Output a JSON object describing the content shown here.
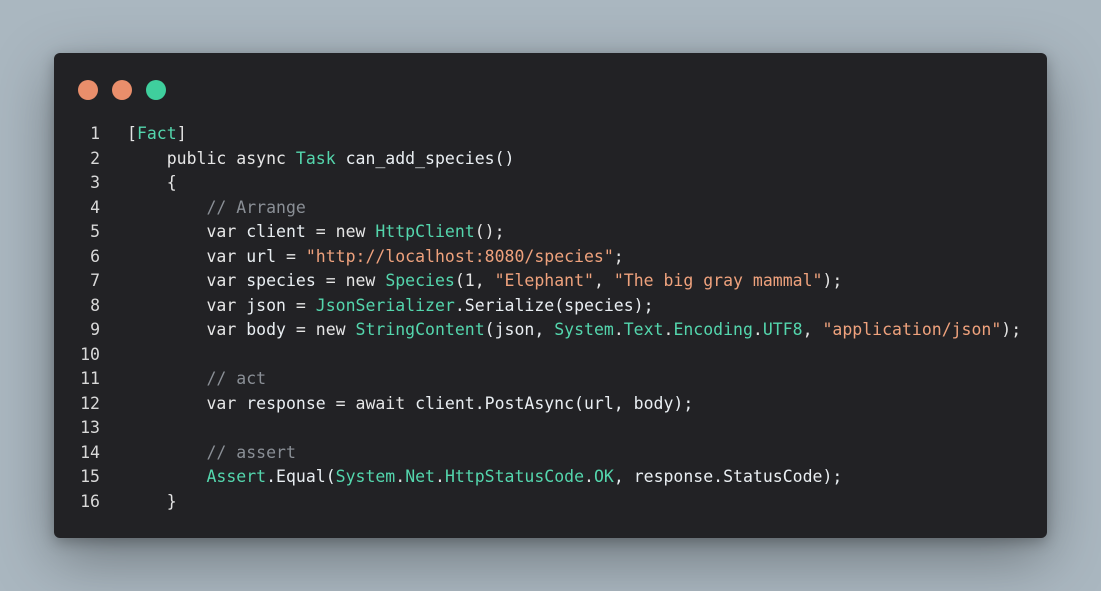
{
  "colors": {
    "background": "#aab7c0",
    "window": "#222225",
    "dot_close": "#e98e6b",
    "dot_minimize": "#e98e6b",
    "dot_maximize": "#3fcf9d"
  },
  "lines": [
    {
      "n": "1",
      "tokens": [
        {
          "t": "[",
          "c": "pun"
        },
        {
          "t": "Fact",
          "c": "cls"
        },
        {
          "t": "]",
          "c": "pun"
        }
      ]
    },
    {
      "n": "2",
      "tokens": [
        {
          "t": "    public async ",
          "c": "kw"
        },
        {
          "t": "Task",
          "c": "cls"
        },
        {
          "t": " can_add_species()",
          "c": "id"
        }
      ]
    },
    {
      "n": "3",
      "tokens": [
        {
          "t": "    {",
          "c": "pun"
        }
      ]
    },
    {
      "n": "4",
      "tokens": [
        {
          "t": "        // Arrange",
          "c": "cmt"
        }
      ]
    },
    {
      "n": "5",
      "tokens": [
        {
          "t": "        var ",
          "c": "kw"
        },
        {
          "t": "client",
          "c": "id"
        },
        {
          "t": " = new ",
          "c": "kw"
        },
        {
          "t": "HttpClient",
          "c": "cls"
        },
        {
          "t": "();",
          "c": "pun"
        }
      ]
    },
    {
      "n": "6",
      "tokens": [
        {
          "t": "        var ",
          "c": "kw"
        },
        {
          "t": "url",
          "c": "id"
        },
        {
          "t": " = ",
          "c": "kw"
        },
        {
          "t": "\"http://localhost:8080/species\"",
          "c": "str"
        },
        {
          "t": ";",
          "c": "pun"
        }
      ]
    },
    {
      "n": "7",
      "tokens": [
        {
          "t": "        var ",
          "c": "kw"
        },
        {
          "t": "species",
          "c": "id"
        },
        {
          "t": " = new ",
          "c": "kw"
        },
        {
          "t": "Species",
          "c": "cls"
        },
        {
          "t": "(1, ",
          "c": "pun"
        },
        {
          "t": "\"Elephant\"",
          "c": "str"
        },
        {
          "t": ", ",
          "c": "pun"
        },
        {
          "t": "\"The big gray mammal\"",
          "c": "str"
        },
        {
          "t": ");",
          "c": "pun"
        }
      ]
    },
    {
      "n": "8",
      "tokens": [
        {
          "t": "        var ",
          "c": "kw"
        },
        {
          "t": "json",
          "c": "id"
        },
        {
          "t": " = ",
          "c": "kw"
        },
        {
          "t": "JsonSerializer",
          "c": "cls"
        },
        {
          "t": ".Serialize(species);",
          "c": "id"
        }
      ]
    },
    {
      "n": "9",
      "tokens": [
        {
          "t": "        var ",
          "c": "kw"
        },
        {
          "t": "body",
          "c": "id"
        },
        {
          "t": " = new ",
          "c": "kw"
        },
        {
          "t": "StringContent",
          "c": "cls"
        },
        {
          "t": "(json, ",
          "c": "id"
        },
        {
          "t": "System",
          "c": "cls"
        },
        {
          "t": ".",
          "c": "pun"
        },
        {
          "t": "Text",
          "c": "cls"
        },
        {
          "t": ".",
          "c": "pun"
        },
        {
          "t": "Encoding",
          "c": "cls"
        },
        {
          "t": ".",
          "c": "pun"
        },
        {
          "t": "UTF8",
          "c": "cls"
        },
        {
          "t": ", ",
          "c": "pun"
        },
        {
          "t": "\"application/json\"",
          "c": "str"
        },
        {
          "t": ");",
          "c": "pun"
        }
      ]
    },
    {
      "n": "10",
      "tokens": []
    },
    {
      "n": "11",
      "tokens": [
        {
          "t": "        // act",
          "c": "cmt"
        }
      ]
    },
    {
      "n": "12",
      "tokens": [
        {
          "t": "        var ",
          "c": "kw"
        },
        {
          "t": "response",
          "c": "id"
        },
        {
          "t": " = await ",
          "c": "kw"
        },
        {
          "t": "client.PostAsync(url, body);",
          "c": "id"
        }
      ]
    },
    {
      "n": "13",
      "tokens": []
    },
    {
      "n": "14",
      "tokens": [
        {
          "t": "        // assert",
          "c": "cmt"
        }
      ]
    },
    {
      "n": "15",
      "tokens": [
        {
          "t": "        ",
          "c": "kw"
        },
        {
          "t": "Assert",
          "c": "cls"
        },
        {
          "t": ".Equal(",
          "c": "id"
        },
        {
          "t": "System",
          "c": "cls"
        },
        {
          "t": ".",
          "c": "pun"
        },
        {
          "t": "Net",
          "c": "cls"
        },
        {
          "t": ".",
          "c": "pun"
        },
        {
          "t": "HttpStatusCode",
          "c": "cls"
        },
        {
          "t": ".",
          "c": "pun"
        },
        {
          "t": "OK",
          "c": "cls"
        },
        {
          "t": ", response.StatusCode);",
          "c": "id"
        }
      ]
    },
    {
      "n": "16",
      "tokens": [
        {
          "t": "    }",
          "c": "pun"
        }
      ]
    }
  ]
}
